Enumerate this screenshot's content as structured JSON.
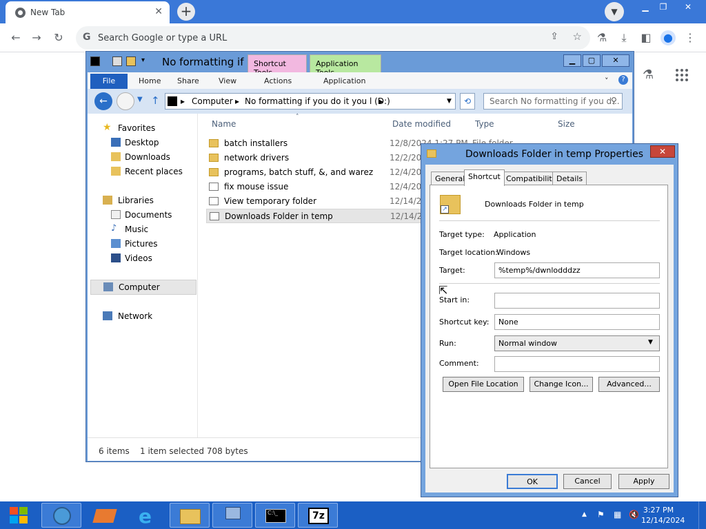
{
  "browser": {
    "tab_title": "New Tab",
    "omnibox_placeholder": "Search Google or type a URL"
  },
  "explorer": {
    "title": "No formatting if ...",
    "context_tabs": [
      "Shortcut Tools",
      "Application Tools"
    ],
    "ribbon_tabs": [
      "File",
      "Home",
      "Share",
      "View",
      "Actions",
      "Application"
    ],
    "address": [
      "Computer",
      "No formatting if you do it you l (D:)"
    ],
    "search_placeholder": "Search No formatting if you d...",
    "nav": {
      "favorites": "Favorites",
      "favorites_items": [
        "Desktop",
        "Downloads",
        "Recent places"
      ],
      "libraries": "Libraries",
      "libraries_items": [
        "Documents",
        "Music",
        "Pictures",
        "Videos"
      ],
      "computer": "Computer",
      "network": "Network"
    },
    "columns": [
      "Name",
      "Date modified",
      "Type",
      "Size"
    ],
    "files": [
      {
        "name": "batch installers",
        "date": "12/8/2024 1:27 PM",
        "type": "File folder",
        "icon": "folder"
      },
      {
        "name": "network drivers",
        "date": "12/2/20",
        "icon": "folder"
      },
      {
        "name": "programs, batch stuff, &, and warez",
        "date": "12/4/20",
        "icon": "folder"
      },
      {
        "name": "fix mouse issue",
        "date": "12/4/20",
        "icon": "shortcut"
      },
      {
        "name": "View temporary folder",
        "date": "12/14/2",
        "icon": "shortcut"
      },
      {
        "name": "Downloads Folder in temp",
        "date": "12/14/2",
        "icon": "shortcut",
        "selected": true
      }
    ],
    "status": {
      "count": "6 items",
      "selection": "1 item selected 708 bytes"
    }
  },
  "dialog": {
    "title": "Downloads Folder in temp Properties",
    "tabs": [
      "General",
      "Shortcut",
      "Compatibility",
      "Details"
    ],
    "name": "Downloads Folder in temp",
    "target_type_label": "Target type:",
    "target_type": "Application",
    "target_location_label": "Target location:",
    "target_location": "Windows",
    "target_label": "Target:",
    "target": "%temp%/dwnlodddzz",
    "start_in_label": "Start in:",
    "start_in": "",
    "shortcut_key_label": "Shortcut key:",
    "shortcut_key": "None",
    "run_label": "Run:",
    "run": "Normal window",
    "comment_label": "Comment:",
    "comment": "",
    "buttons": {
      "open_location": "Open File Location",
      "change_icon": "Change Icon...",
      "advanced": "Advanced...",
      "ok": "OK",
      "cancel": "Cancel",
      "apply": "Apply"
    }
  },
  "taskbar": {
    "time": "3:27 PM",
    "date": "12/14/2024",
    "apps": [
      "ie-icon-blue",
      "ark-icon",
      "internet-explorer-icon",
      "file-explorer-icon",
      "network-icon",
      "cmd-icon",
      "7zip-icon"
    ],
    "sevenzip_label": "7z"
  }
}
